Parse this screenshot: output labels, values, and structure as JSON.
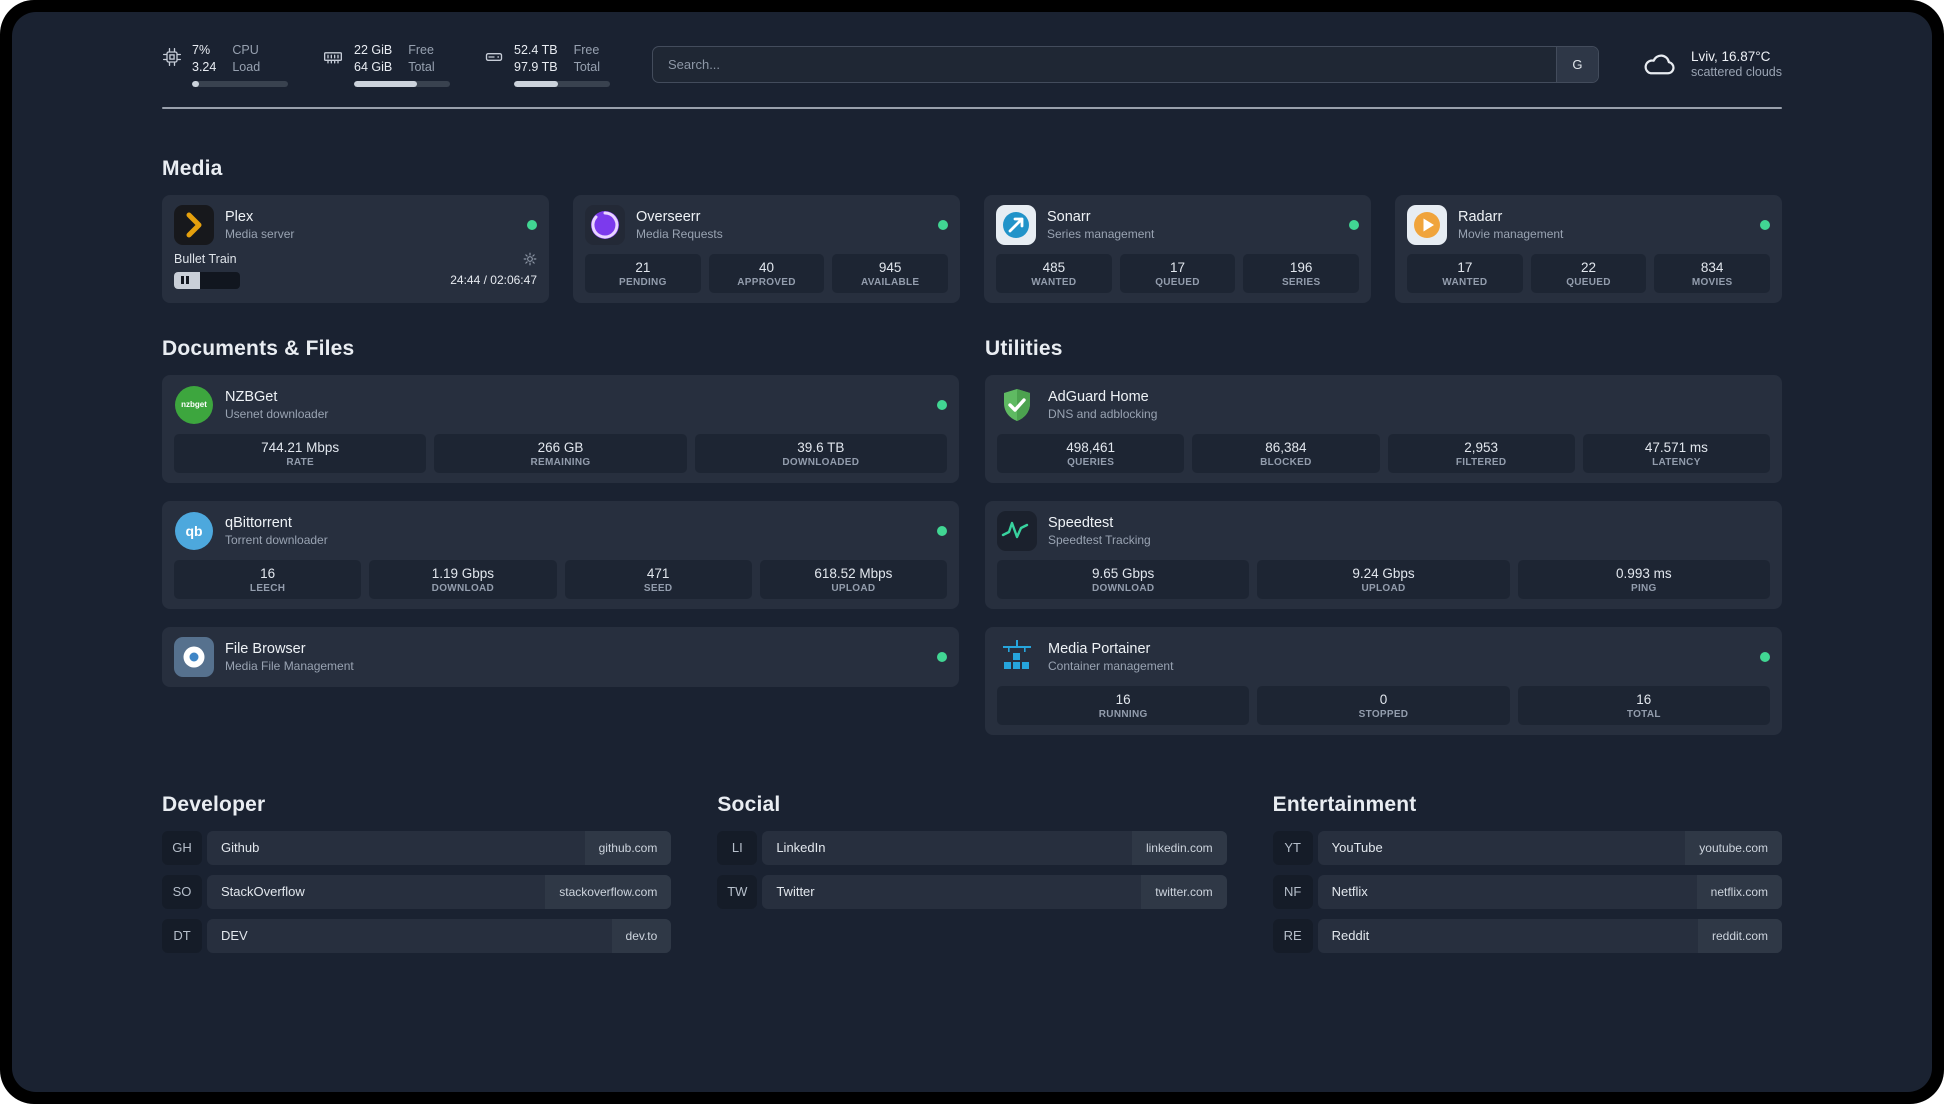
{
  "colors": {
    "status_online": "#41d693",
    "plex_accent": "#e5a00d",
    "adguard_green": "#5fba62",
    "portainer_blue": "#26a5dc",
    "speedtest_green": "#38d39f"
  },
  "topbar": {
    "cpu": {
      "value_top": "7%",
      "value_bottom": "3.24",
      "label_top": "CPU",
      "label_bottom": "Load",
      "percent": 7
    },
    "memory": {
      "value_top": "22 GiB",
      "value_bottom": "64 GiB",
      "label_top": "Free",
      "label_bottom": "Total",
      "percent": 66
    },
    "disk": {
      "value_top": "52.4 TB",
      "value_bottom": "97.9 TB",
      "label_top": "Free",
      "label_bottom": "Total",
      "percent": 46
    },
    "search": {
      "placeholder": "Search...",
      "provider_label": "G"
    },
    "weather": {
      "location": "Lviv, 16.87°C",
      "condition": "scattered clouds"
    }
  },
  "icons": {
    "nzbget_text": "nzbget",
    "qbittorrent_text": "qb"
  },
  "media": {
    "title": "Media",
    "apps": [
      {
        "name": "Plex",
        "subtitle": "Media server",
        "player": {
          "track": "Bullet Train",
          "time": "24:44 / 02:06:47",
          "progress_percent": 40
        }
      },
      {
        "name": "Overseerr",
        "subtitle": "Media Requests",
        "stats": [
          {
            "value": "21",
            "label": "PENDING"
          },
          {
            "value": "40",
            "label": "APPROVED"
          },
          {
            "value": "945",
            "label": "AVAILABLE"
          }
        ]
      },
      {
        "name": "Sonarr",
        "subtitle": "Series management",
        "stats": [
          {
            "value": "485",
            "label": "WANTED"
          },
          {
            "value": "17",
            "label": "QUEUED"
          },
          {
            "value": "196",
            "label": "SERIES"
          }
        ]
      },
      {
        "name": "Radarr",
        "subtitle": "Movie management",
        "stats": [
          {
            "value": "17",
            "label": "WANTED"
          },
          {
            "value": "22",
            "label": "QUEUED"
          },
          {
            "value": "834",
            "label": "MOVIES"
          }
        ]
      }
    ]
  },
  "documents": {
    "title": "Documents & Files",
    "apps": [
      {
        "name": "NZBGet",
        "subtitle": "Usenet downloader",
        "stats": [
          {
            "value": "744.21 Mbps",
            "label": "RATE"
          },
          {
            "value": "266 GB",
            "label": "REMAINING"
          },
          {
            "value": "39.6 TB",
            "label": "DOWNLOADED"
          }
        ]
      },
      {
        "name": "qBittorrent",
        "subtitle": "Torrent downloader",
        "stats": [
          {
            "value": "16",
            "label": "LEECH"
          },
          {
            "value": "1.19 Gbps",
            "label": "DOWNLOAD"
          },
          {
            "value": "471",
            "label": "SEED"
          },
          {
            "value": "618.52 Mbps",
            "label": "UPLOAD"
          }
        ]
      },
      {
        "name": "File Browser",
        "subtitle": "Media File Management"
      }
    ]
  },
  "utilities": {
    "title": "Utilities",
    "apps": [
      {
        "name": "AdGuard Home",
        "subtitle": "DNS and adblocking",
        "stats": [
          {
            "value": "498,461",
            "label": "QUERIES"
          },
          {
            "value": "86,384",
            "label": "BLOCKED"
          },
          {
            "value": "2,953",
            "label": "FILTERED"
          },
          {
            "value": "47.571 ms",
            "label": "LATENCY"
          }
        ]
      },
      {
        "name": "Speedtest",
        "subtitle": "Speedtest Tracking",
        "stats": [
          {
            "value": "9.65 Gbps",
            "label": "DOWNLOAD"
          },
          {
            "value": "9.24 Gbps",
            "label": "UPLOAD"
          },
          {
            "value": "0.993 ms",
            "label": "PING"
          }
        ]
      },
      {
        "name": "Media Portainer",
        "subtitle": "Container management",
        "stats": [
          {
            "value": "16",
            "label": "RUNNING"
          },
          {
            "value": "0",
            "label": "STOPPED"
          },
          {
            "value": "16",
            "label": "TOTAL"
          }
        ]
      }
    ]
  },
  "bookmarks": {
    "groups": [
      {
        "title": "Developer",
        "items": [
          {
            "abbr": "GH",
            "name": "Github",
            "url": "github.com"
          },
          {
            "abbr": "SO",
            "name": "StackOverflow",
            "url": "stackoverflow.com"
          },
          {
            "abbr": "DT",
            "name": "DEV",
            "url": "dev.to"
          }
        ]
      },
      {
        "title": "Social",
        "items": [
          {
            "abbr": "LI",
            "name": "LinkedIn",
            "url": "linkedin.com"
          },
          {
            "abbr": "TW",
            "name": "Twitter",
            "url": "twitter.com"
          }
        ]
      },
      {
        "title": "Entertainment",
        "items": [
          {
            "abbr": "YT",
            "name": "YouTube",
            "url": "youtube.com"
          },
          {
            "abbr": "NF",
            "name": "Netflix",
            "url": "netflix.com"
          },
          {
            "abbr": "RE",
            "name": "Reddit",
            "url": "reddit.com"
          }
        ]
      }
    ]
  }
}
